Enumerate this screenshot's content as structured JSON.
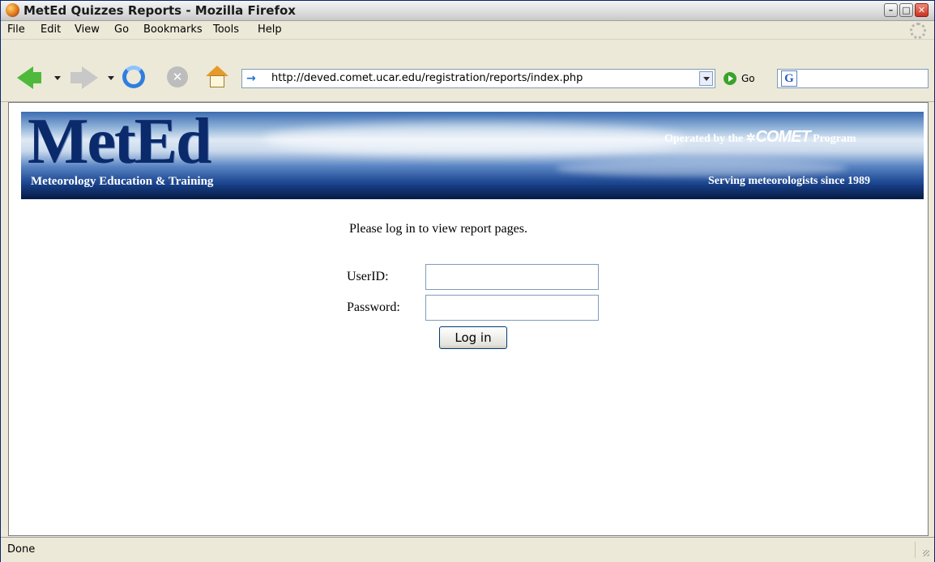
{
  "window": {
    "title": "MetEd Quizzes Reports - Mozilla Firefox",
    "min_glyph": "–",
    "max_glyph": "□",
    "close_glyph": "✕"
  },
  "menu": {
    "items": [
      "File",
      "Edit",
      "View",
      "Go",
      "Bookmarks",
      "Tools",
      "Help"
    ]
  },
  "toolbar": {
    "back_icon": "back-arrow-icon",
    "forward_icon": "forward-arrow-icon",
    "reload_icon": "reload-icon",
    "stop_glyph": "✕",
    "home_icon": "home-icon",
    "url": "http://deved.comet.ucar.edu/registration/reports/index.php",
    "url_icon_glyph": "→",
    "go_label": "Go",
    "search_engine_glyph": "G",
    "search_value": ""
  },
  "banner": {
    "logo": "MetEd",
    "subtitle": "Meteorology Education & Training",
    "operated_prefix": "Operated by the",
    "comet": "COMET",
    "operated_suffix": "Program",
    "serving": "Serving meteorologists since 1989"
  },
  "login": {
    "prompt": "Please log in to view report pages.",
    "userid_label": "UserID:",
    "userid_value": "",
    "password_label": "Password:",
    "password_value": "",
    "button_label": "Log in"
  },
  "status": {
    "text": "Done"
  }
}
